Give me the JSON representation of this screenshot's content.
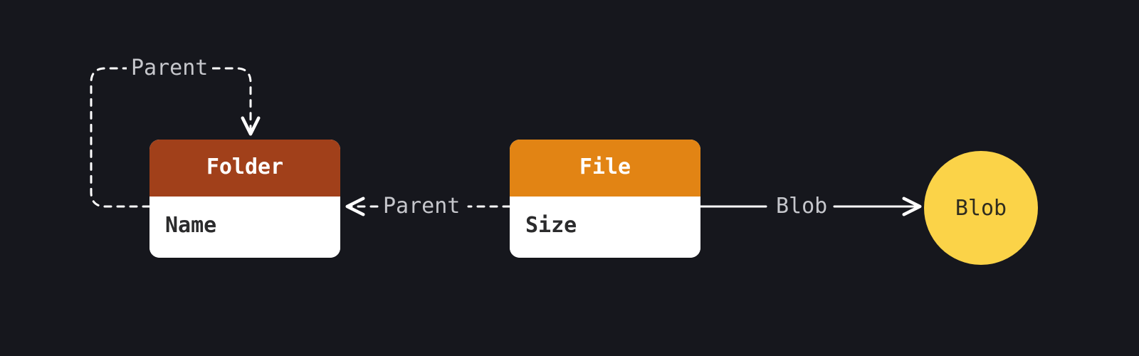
{
  "entities": {
    "folder": {
      "title": "Folder",
      "attribute": "Name",
      "header_color": "#a1401a"
    },
    "file": {
      "title": "File",
      "attribute": "Size",
      "header_color": "#e28414"
    },
    "blob": {
      "label": "Blob",
      "fill_color": "#fbd348"
    }
  },
  "edges": {
    "folder_self_parent": {
      "label": "Parent",
      "style": "dashed",
      "from": "folder",
      "to": "folder"
    },
    "file_to_folder_parent": {
      "label": "Parent",
      "style": "dashed",
      "from": "file",
      "to": "folder"
    },
    "file_to_blob": {
      "label": "Blob",
      "style": "solid",
      "from": "file",
      "to": "blob"
    }
  },
  "colors": {
    "background": "#16171d",
    "edge": "#ffffff",
    "edge_label": "#c6c7cc",
    "body": "#ffffff",
    "body_text": "#2b2b2c"
  }
}
